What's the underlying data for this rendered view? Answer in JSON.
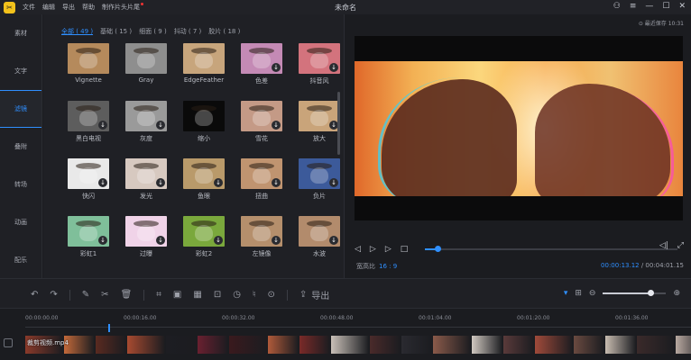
{
  "app": {
    "title": "未命名",
    "logo_glyph": "✂",
    "menu": [
      "文件",
      "编辑",
      "导出",
      "帮助",
      "制作片头片尾"
    ],
    "autosave": "⊙ 最近保存 10:31",
    "window_controls": [
      "user-icon",
      "menu-icon",
      "minimize-icon",
      "maximize-icon",
      "close-icon"
    ]
  },
  "sidebar": {
    "items": [
      {
        "label": "素材",
        "active": false
      },
      {
        "label": "文字",
        "active": false
      },
      {
        "label": "滤镜",
        "active": true
      },
      {
        "label": "叠附",
        "active": false
      },
      {
        "label": "转场",
        "active": false
      },
      {
        "label": "动画",
        "active": false
      },
      {
        "label": "配乐",
        "active": false
      }
    ]
  },
  "filters": {
    "tabs": [
      {
        "label": "全部 ( 49 )",
        "active": true
      },
      {
        "label": "基础 ( 15 )",
        "active": false
      },
      {
        "label": "细面 ( 9 )",
        "active": false
      },
      {
        "label": "抖动 ( 7 )",
        "active": false
      },
      {
        "label": "胶片 ( 18 )",
        "active": false
      }
    ],
    "tiles": [
      {
        "label": "Vignette",
        "bg": "#b58a5c",
        "download": false
      },
      {
        "label": "Gray",
        "bg": "#8e8e8e",
        "download": false
      },
      {
        "label": "EdgeFeather",
        "bg": "#c7a57c",
        "download": false
      },
      {
        "label": "色差",
        "bg": "#c48ab5",
        "download": true
      },
      {
        "label": "抖音风",
        "bg": "#d3737d",
        "download": true
      },
      {
        "label": "黑白电视",
        "bg": "#5d5d5d",
        "download": true
      },
      {
        "label": "灰度",
        "bg": "#9a9a9a",
        "download": true
      },
      {
        "label": "缩小",
        "bg": "#0a0a0a",
        "download": false
      },
      {
        "label": "雪花",
        "bg": "#c49a86",
        "download": true
      },
      {
        "label": "放大",
        "bg": "#c9a47a",
        "download": true
      },
      {
        "label": "快闪",
        "bg": "#e9e9e9",
        "download": true
      },
      {
        "label": "发光",
        "bg": "#d7c9c0",
        "download": true
      },
      {
        "label": "鱼眼",
        "bg": "#b99a6a",
        "download": true
      },
      {
        "label": "扭曲",
        "bg": "#c09470",
        "download": true
      },
      {
        "label": "负片",
        "bg": "#3c5a9a",
        "download": true
      },
      {
        "label": "彩虹1",
        "bg": "#7fbf9a",
        "download": true
      },
      {
        "label": "过曝",
        "bg": "#f0d3e8",
        "download": true
      },
      {
        "label": "彩虹2",
        "bg": "#7aa83c",
        "download": true
      },
      {
        "label": "左镜像",
        "bg": "#b58f6c",
        "download": true
      },
      {
        "label": "水波",
        "bg": "#b28b6c",
        "download": true
      }
    ]
  },
  "preview": {
    "aspect_label": "宽高比",
    "aspect_value": "16 : 9",
    "current_time": "00:00:13.12",
    "total_time": " / 00:04:01.15",
    "progress": 0.05,
    "controls": [
      "prev-frame-icon",
      "play-icon",
      "next-frame-icon",
      "stop-icon"
    ],
    "right_controls": [
      "volume-icon",
      "fullscreen-icon"
    ]
  },
  "toolbar": {
    "export_label": "导出",
    "zoom_level": 0.75
  },
  "timeline": {
    "ticks": [
      "00:00:00.00",
      "00:00:16.00",
      "00:00:32.00",
      "00:00:48.00",
      "00:01:04.00",
      "00:01:20.00",
      "00:01:36.00"
    ],
    "clip_label": "裁剪视频.mp4",
    "clip_colors": [
      "#8a3a2a",
      "#c46a3a",
      "#5a2a20",
      "#a84a30",
      "#1d1d22",
      "#6a2030",
      "#3a1a1e",
      "#b05a3a",
      "#7a2a28",
      "#c9c0b8",
      "#4a2a2a",
      "#2a2a30",
      "#8a5a4a",
      "#d0c8c0",
      "#5a3a3a",
      "#a04a3a",
      "#6a4a40",
      "#c8bcb0",
      "#3a2a2a",
      "#b8a8a0"
    ]
  }
}
